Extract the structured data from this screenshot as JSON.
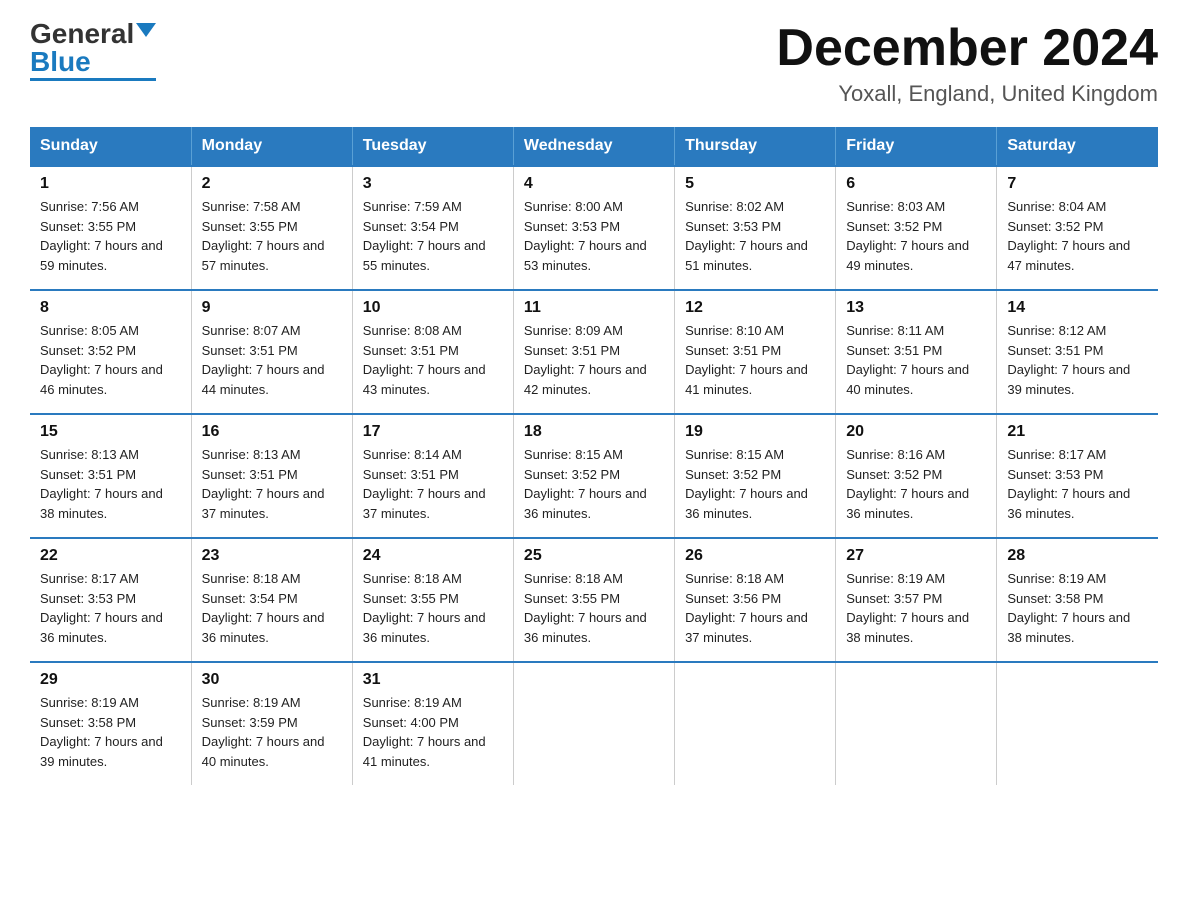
{
  "header": {
    "logo_general": "General",
    "logo_blue": "Blue",
    "month_title": "December 2024",
    "location": "Yoxall, England, United Kingdom"
  },
  "days_of_week": [
    "Sunday",
    "Monday",
    "Tuesday",
    "Wednesday",
    "Thursday",
    "Friday",
    "Saturday"
  ],
  "weeks": [
    [
      {
        "day": "1",
        "sunrise": "7:56 AM",
        "sunset": "3:55 PM",
        "daylight": "7 hours and 59 minutes."
      },
      {
        "day": "2",
        "sunrise": "7:58 AM",
        "sunset": "3:55 PM",
        "daylight": "7 hours and 57 minutes."
      },
      {
        "day": "3",
        "sunrise": "7:59 AM",
        "sunset": "3:54 PM",
        "daylight": "7 hours and 55 minutes."
      },
      {
        "day": "4",
        "sunrise": "8:00 AM",
        "sunset": "3:53 PM",
        "daylight": "7 hours and 53 minutes."
      },
      {
        "day": "5",
        "sunrise": "8:02 AM",
        "sunset": "3:53 PM",
        "daylight": "7 hours and 51 minutes."
      },
      {
        "day": "6",
        "sunrise": "8:03 AM",
        "sunset": "3:52 PM",
        "daylight": "7 hours and 49 minutes."
      },
      {
        "day": "7",
        "sunrise": "8:04 AM",
        "sunset": "3:52 PM",
        "daylight": "7 hours and 47 minutes."
      }
    ],
    [
      {
        "day": "8",
        "sunrise": "8:05 AM",
        "sunset": "3:52 PM",
        "daylight": "7 hours and 46 minutes."
      },
      {
        "day": "9",
        "sunrise": "8:07 AM",
        "sunset": "3:51 PM",
        "daylight": "7 hours and 44 minutes."
      },
      {
        "day": "10",
        "sunrise": "8:08 AM",
        "sunset": "3:51 PM",
        "daylight": "7 hours and 43 minutes."
      },
      {
        "day": "11",
        "sunrise": "8:09 AM",
        "sunset": "3:51 PM",
        "daylight": "7 hours and 42 minutes."
      },
      {
        "day": "12",
        "sunrise": "8:10 AM",
        "sunset": "3:51 PM",
        "daylight": "7 hours and 41 minutes."
      },
      {
        "day": "13",
        "sunrise": "8:11 AM",
        "sunset": "3:51 PM",
        "daylight": "7 hours and 40 minutes."
      },
      {
        "day": "14",
        "sunrise": "8:12 AM",
        "sunset": "3:51 PM",
        "daylight": "7 hours and 39 minutes."
      }
    ],
    [
      {
        "day": "15",
        "sunrise": "8:13 AM",
        "sunset": "3:51 PM",
        "daylight": "7 hours and 38 minutes."
      },
      {
        "day": "16",
        "sunrise": "8:13 AM",
        "sunset": "3:51 PM",
        "daylight": "7 hours and 37 minutes."
      },
      {
        "day": "17",
        "sunrise": "8:14 AM",
        "sunset": "3:51 PM",
        "daylight": "7 hours and 37 minutes."
      },
      {
        "day": "18",
        "sunrise": "8:15 AM",
        "sunset": "3:52 PM",
        "daylight": "7 hours and 36 minutes."
      },
      {
        "day": "19",
        "sunrise": "8:15 AM",
        "sunset": "3:52 PM",
        "daylight": "7 hours and 36 minutes."
      },
      {
        "day": "20",
        "sunrise": "8:16 AM",
        "sunset": "3:52 PM",
        "daylight": "7 hours and 36 minutes."
      },
      {
        "day": "21",
        "sunrise": "8:17 AM",
        "sunset": "3:53 PM",
        "daylight": "7 hours and 36 minutes."
      }
    ],
    [
      {
        "day": "22",
        "sunrise": "8:17 AM",
        "sunset": "3:53 PM",
        "daylight": "7 hours and 36 minutes."
      },
      {
        "day": "23",
        "sunrise": "8:18 AM",
        "sunset": "3:54 PM",
        "daylight": "7 hours and 36 minutes."
      },
      {
        "day": "24",
        "sunrise": "8:18 AM",
        "sunset": "3:55 PM",
        "daylight": "7 hours and 36 minutes."
      },
      {
        "day": "25",
        "sunrise": "8:18 AM",
        "sunset": "3:55 PM",
        "daylight": "7 hours and 36 minutes."
      },
      {
        "day": "26",
        "sunrise": "8:18 AM",
        "sunset": "3:56 PM",
        "daylight": "7 hours and 37 minutes."
      },
      {
        "day": "27",
        "sunrise": "8:19 AM",
        "sunset": "3:57 PM",
        "daylight": "7 hours and 38 minutes."
      },
      {
        "day": "28",
        "sunrise": "8:19 AM",
        "sunset": "3:58 PM",
        "daylight": "7 hours and 38 minutes."
      }
    ],
    [
      {
        "day": "29",
        "sunrise": "8:19 AM",
        "sunset": "3:58 PM",
        "daylight": "7 hours and 39 minutes."
      },
      {
        "day": "30",
        "sunrise": "8:19 AM",
        "sunset": "3:59 PM",
        "daylight": "7 hours and 40 minutes."
      },
      {
        "day": "31",
        "sunrise": "8:19 AM",
        "sunset": "4:00 PM",
        "daylight": "7 hours and 41 minutes."
      },
      null,
      null,
      null,
      null
    ]
  ]
}
